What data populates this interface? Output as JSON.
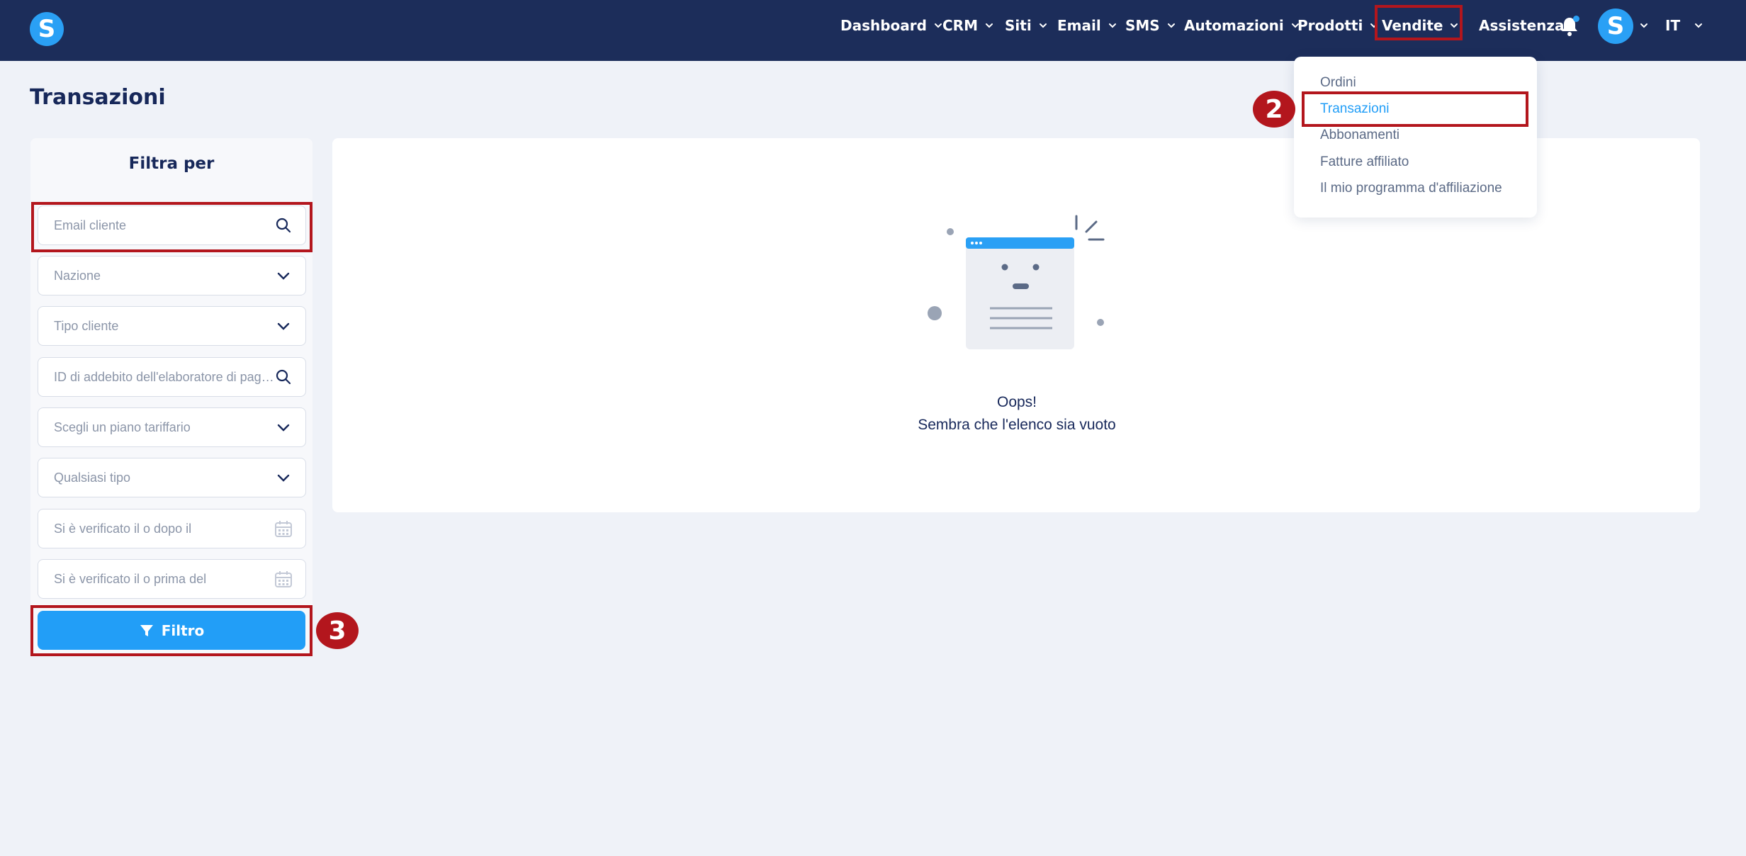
{
  "colors": {
    "topbar": "#1c2d5a",
    "accent": "#229ef7",
    "highlight": "#b3161d",
    "background": "#eff2f8"
  },
  "header": {
    "logo_letter": "S",
    "nav": [
      {
        "label": "Dashboard",
        "icon": "chevron-down-icon"
      },
      {
        "label": "CRM",
        "icon": "chevron-down-icon"
      },
      {
        "label": "Siti",
        "icon": "chevron-down-icon"
      },
      {
        "label": "Email",
        "icon": "chevron-down-icon"
      },
      {
        "label": "SMS",
        "icon": "chevron-down-icon"
      },
      {
        "label": "Automazioni",
        "icon": "chevron-down-icon"
      },
      {
        "label": "Prodotti",
        "icon": "chevron-down-icon"
      },
      {
        "label": "Vendite",
        "icon": "chevron-down-icon"
      }
    ],
    "help_label": "Assistenza",
    "notification_icon": "bell-icon",
    "avatar_letter": "S",
    "language": "IT"
  },
  "dropdown": {
    "items": [
      "Ordini",
      "Transazioni",
      "Abbonamenti",
      "Fatture affiliato",
      "Il mio programma d'affiliazione"
    ],
    "active": "Transazioni"
  },
  "page": {
    "title": "Transazioni"
  },
  "filters": {
    "title": "Filtra per",
    "fields": [
      {
        "placeholder": "Email cliente",
        "icon": "search-icon"
      },
      {
        "placeholder": "Nazione",
        "icon": "chevron-down-icon"
      },
      {
        "placeholder": "Tipo cliente",
        "icon": "chevron-down-icon"
      },
      {
        "placeholder": "ID di addebito dell'elaboratore di pagamento",
        "icon": "search-icon"
      },
      {
        "placeholder": "Scegli un piano tariffario",
        "icon": "chevron-down-icon"
      },
      {
        "placeholder": "Qualsiasi tipo",
        "icon": "chevron-down-icon"
      },
      {
        "placeholder": "Si è verificato il o dopo il",
        "icon": "calendar-icon"
      },
      {
        "placeholder": "Si è verificato il o prima del",
        "icon": "calendar-icon"
      }
    ],
    "button_label": "Filtro",
    "button_icon": "filter-icon"
  },
  "empty_state": {
    "line1": "Oops!",
    "line2": "Sembra che l'elenco sia vuoto"
  },
  "annotations": {
    "step_dropdown": "2",
    "step_button": "3"
  }
}
